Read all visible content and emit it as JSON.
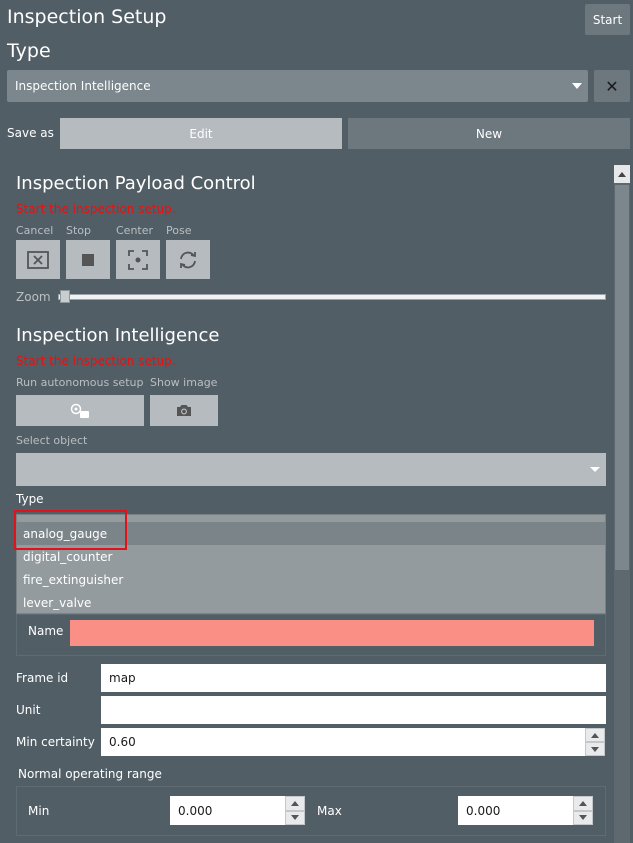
{
  "header": {
    "title": "Inspection Setup",
    "start_label": "Start"
  },
  "type_section": {
    "heading": "Type",
    "selected": "Inspection Intelligence",
    "close_symbol": "✕"
  },
  "save_as": {
    "label": "Save as",
    "edit_label": "Edit",
    "new_label": "New"
  },
  "payload_control": {
    "heading": "Inspection Payload Control",
    "status": "Start the inspection setup.",
    "buttons": [
      {
        "label": "Cancel",
        "icon": "cancel-x-icon"
      },
      {
        "label": "Stop",
        "icon": "stop-square-icon"
      },
      {
        "label": "Center",
        "icon": "center-focus-icon"
      },
      {
        "label": "Pose",
        "icon": "sync-arrows-icon"
      }
    ],
    "zoom_label": "Zoom",
    "zoom_value": 0.0
  },
  "intelligence": {
    "heading": "Inspection Intelligence",
    "status": "Start the inspection setup.",
    "run_label": "Run autonomous setup",
    "show_image_label": "Show image",
    "run_icon": "autonomous-setup-icon",
    "show_image_icon": "camera-icon",
    "select_object_label": "Select object",
    "select_object_value": "",
    "type_label": "Type",
    "type_options": [
      "analog_gauge",
      "digital_counter",
      "fire_extinguisher",
      "lever_valve"
    ],
    "type_selected": "analog_gauge",
    "name_label": "Name",
    "name_value": "",
    "frame_id_label": "Frame id",
    "frame_id_value": "map",
    "unit_label": "Unit",
    "unit_value": "",
    "min_certainty_label": "Min certainty",
    "min_certainty_value": "0.60",
    "range_label": "Normal operating range",
    "min_label": "Min",
    "min_value": "0.000",
    "max_label": "Max",
    "max_value": "0.000"
  },
  "colors": {
    "background": "#525e66",
    "status_red": "#e31212",
    "name_error_fill": "#fa8f85",
    "highlight_red": "#e0121a"
  }
}
